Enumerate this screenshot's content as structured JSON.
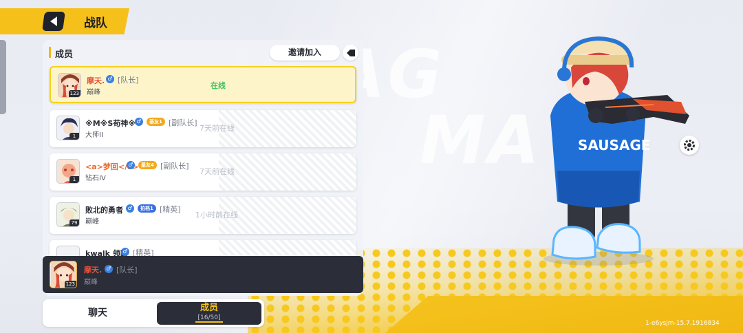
{
  "header": {
    "title": "战队"
  },
  "panel": {
    "title": "成员",
    "invite_label": "邀请加入"
  },
  "members": [
    {
      "name": "摩天.",
      "role": "[队长]",
      "rank": "巅峰",
      "status": "在线",
      "level": "123"
    },
    {
      "name": "※M※S苟神※",
      "badge": "基友1",
      "role": "[副队长]",
      "rank": "大师II",
      "status": "7天前在线",
      "level": "1"
    },
    {
      "name": "<a>梦回</a>",
      "badge": "基友4",
      "role": "[副队长]",
      "rank": "钻石IV",
      "status": "7天前在线",
      "level": "1"
    },
    {
      "name": "败北的勇者",
      "badge": "拍档1",
      "role": "[精英]",
      "rank": "巅峰",
      "status": "1小时前在线",
      "level": "79"
    },
    {
      "name": "kwalk 领路",
      "role": "[精英]",
      "rank": "",
      "status": "",
      "level": ""
    }
  ],
  "selected": {
    "name": "摩天.",
    "role": "[队长]",
    "rank": "巅峰",
    "level": "123"
  },
  "tabs": {
    "chat_label": "聊天",
    "members_label": "成员",
    "members_count": "[16/50]"
  },
  "background_logo": {
    "line1": "USAG",
    "line2": "MA"
  },
  "version": "1-e6ysjm-15.7.1916834",
  "colors": {
    "accent": "#f6c01b",
    "dark": "#2b2e38",
    "online": "#48bf61",
    "male": "#3a7fe0"
  },
  "icons": [
    "back-icon",
    "quit-icon",
    "gear-icon",
    "male-icon"
  ]
}
